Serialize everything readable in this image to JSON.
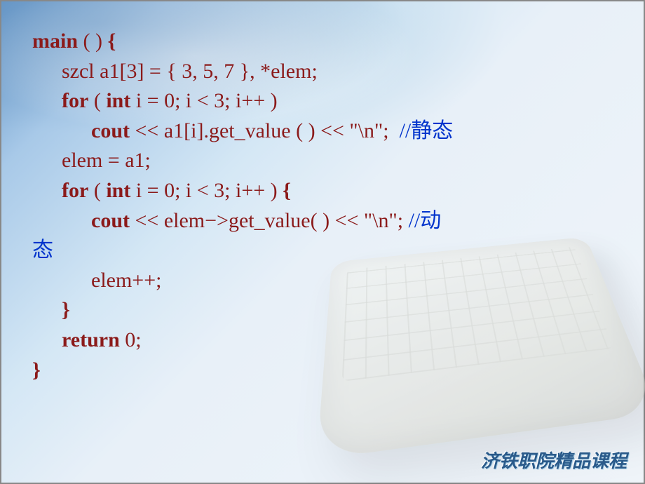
{
  "code": {
    "l1_kw": "main",
    "l1_rest": " ( ) ",
    "l1_brace": "{",
    "l2": "szcl a1[3] = { 3, 5, 7 }, *elem;",
    "l3_kw1": "for",
    "l3_mid1": " ( ",
    "l3_kw2": "int",
    "l3_rest": " i = 0; i < 3; i++ )",
    "l4_kw": "cout",
    "l4_rest": " << a1[i].get_value ( ) << \"\\n\";  ",
    "l4_comment": "//静态",
    "l5": "elem = a1;",
    "l6_kw1": "for",
    "l6_mid1": " ( ",
    "l6_kw2": "int",
    "l6_rest": " i = 0; i < 3; i++ ) ",
    "l6_brace": "{",
    "l7_kw": "cout",
    "l7_rest": " << elem−>get_value( ) << \"\\n\"; ",
    "l7_comment": "//动",
    "l7_comment_wrap": "态",
    "l8": "elem++;",
    "l9_brace": "}",
    "l10_kw": "return",
    "l10_rest": " 0;",
    "l11_brace": "}"
  },
  "watermark": "济铁职院精品课程"
}
